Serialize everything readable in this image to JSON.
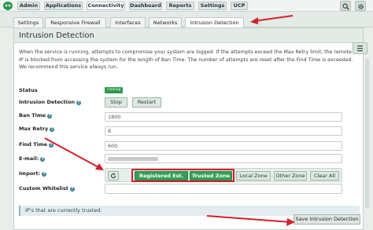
{
  "topnav": {
    "items": [
      "Admin",
      "Applications",
      "Connectivity",
      "Dashboard",
      "Reports",
      "Settings",
      "UCP"
    ]
  },
  "subtabs": [
    "Settings",
    "Responsive Firewall",
    "Interfaces",
    "Networks",
    "Intrusion Detection"
  ],
  "panel": {
    "title": "Intrusion Detection",
    "description": "When the service is running, attempts to compromise your system are logged. If the attempts exceed the Max Retry limit, the remote IP is blocked from accessing the system for the length of Ban Time. The number of attempts are reset after the Find Time is exceeded. We recommend this service always run."
  },
  "form": {
    "status_label": "Status",
    "status_value": "running",
    "ids_label": "Intrusion Detection",
    "stop_label": "Stop",
    "restart_label": "Restart",
    "ban_time_label": "Ban Time",
    "ban_time_value": "1800",
    "max_retry_label": "Max Retry",
    "max_retry_value": "8",
    "find_time_label": "Find Time",
    "find_time_value": "600",
    "email_label": "E-mail:",
    "import_label": "Import:",
    "import_buttons": {
      "registered": "Registered Est. IPs",
      "trusted": "Trusted Zone",
      "local": "Local Zone",
      "other": "Other Zone",
      "clear": "Clear All"
    },
    "whitelist_label": "Custom Whitelist"
  },
  "trusted_banner": "IP's that are currently trusted.",
  "save_label": "Save Intrusion Detection",
  "colors": {
    "accent_green": "#34a058",
    "highlight_red": "#d4202a"
  }
}
